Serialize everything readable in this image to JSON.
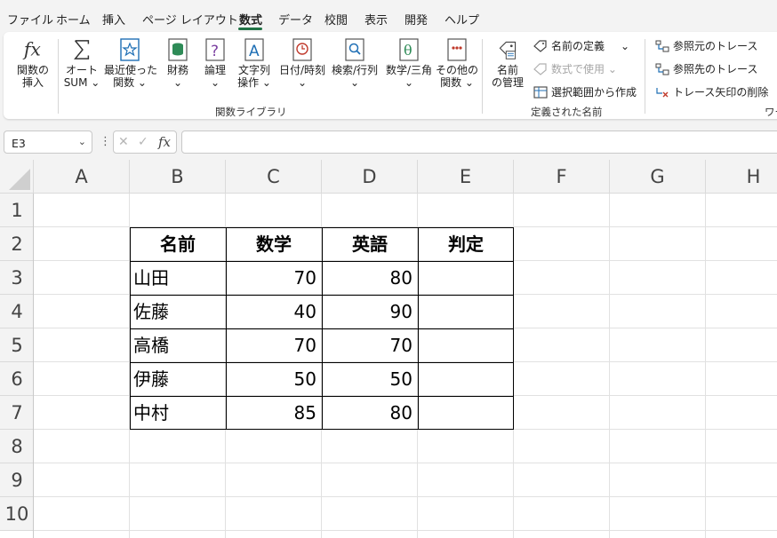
{
  "menu": [
    "ファイル",
    "ホーム",
    "挿入",
    "ページ レイアウト",
    "数式",
    "データ",
    "校閲",
    "表示",
    "開発",
    "ヘルプ"
  ],
  "ribbon": {
    "insert_function": {
      "line1": "関数の",
      "line2": "挿入",
      "icon": "fx-icon"
    },
    "autosum": {
      "line1": "オート",
      "line2": "SUM ⌄",
      "icon": "sigma-icon"
    },
    "recent": {
      "line1": "最近使った",
      "line2": "関数 ⌄",
      "icon": "star-icon"
    },
    "financial": {
      "line1": "財務",
      "line2": "⌄",
      "icon": "coins-icon"
    },
    "logical": {
      "line1": "論理",
      "line2": "⌄",
      "icon": "question-icon"
    },
    "text": {
      "line1": "文字列",
      "line2": "操作 ⌄",
      "icon": "letter-a-icon"
    },
    "datetime": {
      "line1": "日付/時刻",
      "line2": "⌄",
      "icon": "clock-icon"
    },
    "lookup": {
      "line1": "検索/行列",
      "line2": "⌄",
      "icon": "magnifier-icon"
    },
    "math": {
      "line1": "数学/三角",
      "line2": "⌄",
      "icon": "theta-icon"
    },
    "more": {
      "line1": "その他の",
      "line2": "関数 ⌄",
      "icon": "dots-icon"
    },
    "group_function_library": "関数ライブラリ",
    "name_manager": {
      "line1": "名前",
      "line2": "の管理",
      "icon": "tag-icon"
    },
    "define_name": "名前の定義",
    "define_name_chevron": "⌄",
    "use_in_formula": "数式で使用 ⌄",
    "create_from_selection": "選択範囲から作成",
    "group_defined_names": "定義された名前",
    "trace_precedents": "参照元のトレース",
    "trace_dependents": "参照先のトレース",
    "remove_arrows": "トレース矢印の削除",
    "remove_arrows_chevron": "⌄",
    "group_formula_auditing": "ワー"
  },
  "formula_bar": {
    "name_box": "E3",
    "name_box_chevron": "⌄",
    "more": "⋮",
    "cancel": "✕",
    "enter": "✓",
    "fx": "fx",
    "formula": ""
  },
  "columns": [
    "A",
    "B",
    "C",
    "D",
    "E",
    "F",
    "G",
    "H"
  ],
  "rows": [
    "1",
    "2",
    "3",
    "4",
    "5",
    "6",
    "7",
    "8",
    "9",
    "10"
  ],
  "table": {
    "headers": [
      "名前",
      "数学",
      "英語",
      "判定"
    ],
    "rows": [
      [
        "山田",
        "70",
        "80",
        ""
      ],
      [
        "佐藤",
        "40",
        "90",
        ""
      ],
      [
        "高橋",
        "70",
        "70",
        ""
      ],
      [
        "伊藤",
        "50",
        "50",
        ""
      ],
      [
        "中村",
        "85",
        "80",
        ""
      ]
    ]
  },
  "colors": {
    "accent": "#217346",
    "icon_blue": "#1f6fb5",
    "icon_red": "#c0392b",
    "icon_green": "#2e8b57",
    "icon_purple": "#7b3fa0"
  }
}
